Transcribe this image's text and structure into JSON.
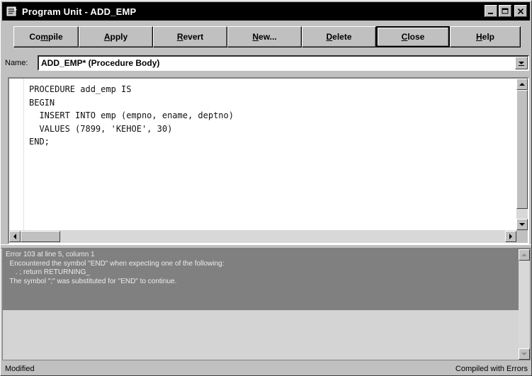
{
  "window": {
    "title": "Program Unit - ADD_EMP",
    "controls": {
      "minimize": "_",
      "maximize": "□",
      "close": "×"
    }
  },
  "toolbar": {
    "compile": {
      "pre": "Co",
      "ul": "m",
      "post": "pile"
    },
    "apply": {
      "pre": "",
      "ul": "A",
      "post": "pply"
    },
    "revert": {
      "pre": "",
      "ul": "R",
      "post": "evert"
    },
    "new": {
      "pre": "",
      "ul": "N",
      "post": "ew..."
    },
    "delete": {
      "pre": "",
      "ul": "D",
      "post": "elete"
    },
    "close": {
      "pre": "",
      "ul": "C",
      "post": "lose"
    },
    "help": {
      "pre": "",
      "ul": "H",
      "post": "elp"
    }
  },
  "name_field": {
    "label": "Name:",
    "value": "ADD_EMP* (Procedure Body)"
  },
  "editor": {
    "lines": [
      "PROCEDURE add_emp IS",
      "BEGIN",
      "  INSERT INTO emp (empno, ename, deptno)",
      "  VALUES (7899, 'KEHOE', 30)",
      "END;"
    ]
  },
  "messages": {
    "lines": [
      "Error 103 at line 5, column 1",
      "  Encountered the symbol \"END\" when expecting one of the following:",
      "",
      "     . ; return RETURNING_",
      "  The symbol \";\" was substituted for \"END\" to continue."
    ]
  },
  "status": {
    "left": "Modified",
    "right": "Compiled with Errors"
  },
  "icons": {
    "app": "program-unit-icon",
    "dropdown": "chevron-down-icon",
    "scroll_up": "arrow-up-icon",
    "scroll_down": "arrow-down-icon",
    "scroll_left": "arrow-left-icon",
    "scroll_right": "arrow-right-icon"
  },
  "colors": {
    "titlebar": "#000000",
    "face": "#c0c0c0",
    "error_block": "#808080",
    "error_text": "#ececec"
  }
}
